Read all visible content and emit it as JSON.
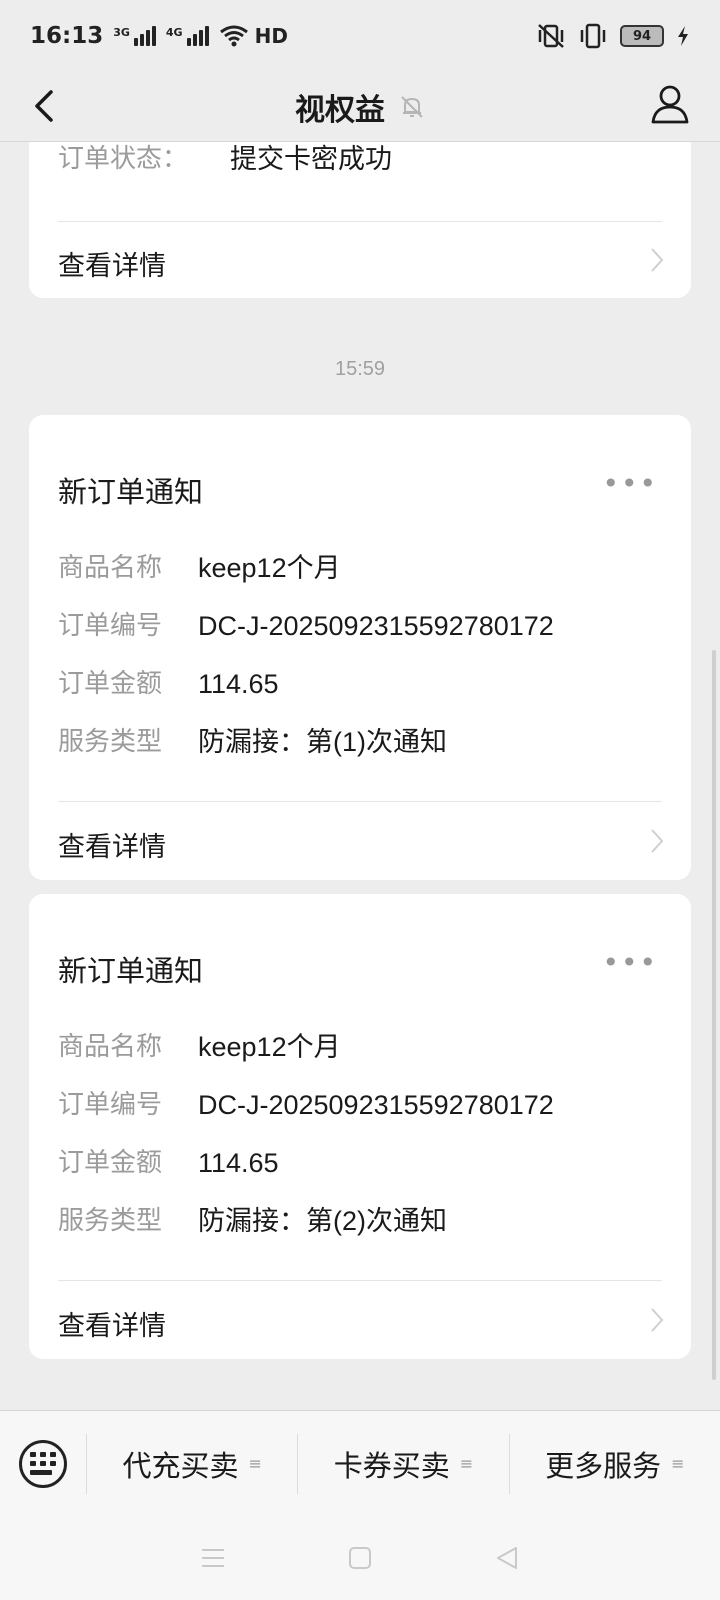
{
  "status_bar": {
    "time": "16:13",
    "net1": "3G",
    "net2": "4G",
    "hd": "HD",
    "battery": "94"
  },
  "header": {
    "title": "视权益"
  },
  "cards": [
    {
      "order_status_label": "订单状态：",
      "order_status_value": "提交卡密成功",
      "detail_label": "查看详情"
    },
    {
      "title": "新订单通知",
      "more": "•••",
      "fields": [
        {
          "key": "商品名称",
          "value": "keep12个月"
        },
        {
          "key": "订单编号",
          "value": "DC-J-2025092315592780172"
        },
        {
          "key": "订单金额",
          "value": "114.65"
        },
        {
          "key": "服务类型",
          "value": "防漏接：第(1)次通知"
        }
      ],
      "detail_label": "查看详情"
    },
    {
      "title": "新订单通知",
      "more": "•••",
      "fields": [
        {
          "key": "商品名称",
          "value": "keep12个月"
        },
        {
          "key": "订单编号",
          "value": "DC-J-2025092315592780172"
        },
        {
          "key": "订单金额",
          "value": "114.65"
        },
        {
          "key": "服务类型",
          "value": "防漏接：第(2)次通知"
        }
      ],
      "detail_label": "查看详情"
    }
  ],
  "timestamp": "15:59",
  "menu": {
    "items": [
      "代充买卖",
      "卡券买卖",
      "更多服务"
    ],
    "ham": "≡"
  },
  "colors": {
    "background": "#ededed",
    "card": "#ffffff",
    "muted_text": "#9b9b9b"
  }
}
